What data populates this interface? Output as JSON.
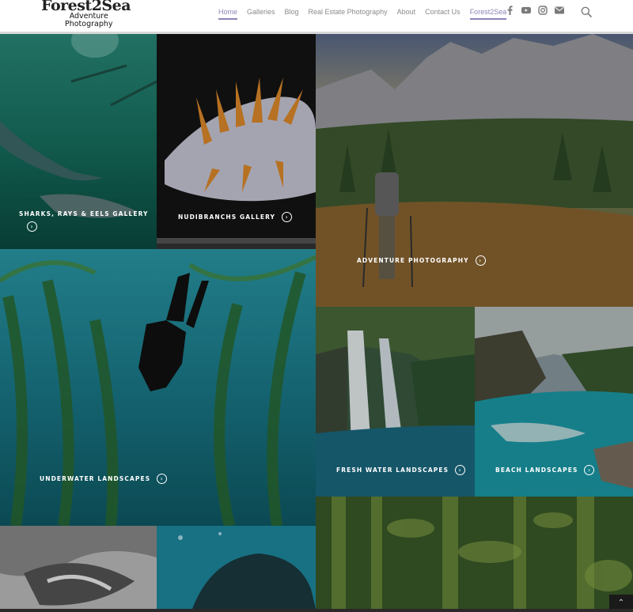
{
  "header": {
    "logo_main": "Forest2Sea",
    "logo_sub_1": "Adventure",
    "logo_sub_2": "Photography",
    "nav": [
      {
        "label": "Home",
        "active": true
      },
      {
        "label": "Galleries",
        "active": false
      },
      {
        "label": "Blog",
        "active": false
      },
      {
        "label": "Real Estate Photography",
        "active": false
      },
      {
        "label": "About",
        "active": false
      },
      {
        "label": "Contact Us",
        "active": false
      },
      {
        "label": "Forest2Sea",
        "active": true
      }
    ],
    "social_icons": [
      "facebook-icon",
      "youtube-icon",
      "instagram-icon",
      "email-icon"
    ],
    "accent_color": "#8b86b8"
  },
  "galleries": {
    "sharks": "SHARKS, RAYS & EELS GALLERY",
    "nudibranchs": "NUDIBRANCHS GALLERY",
    "adventure": "ADVENTURE PHOTOGRAPHY",
    "underwater": "UNDERWATER LANDSCAPES",
    "freshwater": "FRESH WATER LANDSCAPES",
    "beach": "BEACH LANDSCAPES"
  }
}
